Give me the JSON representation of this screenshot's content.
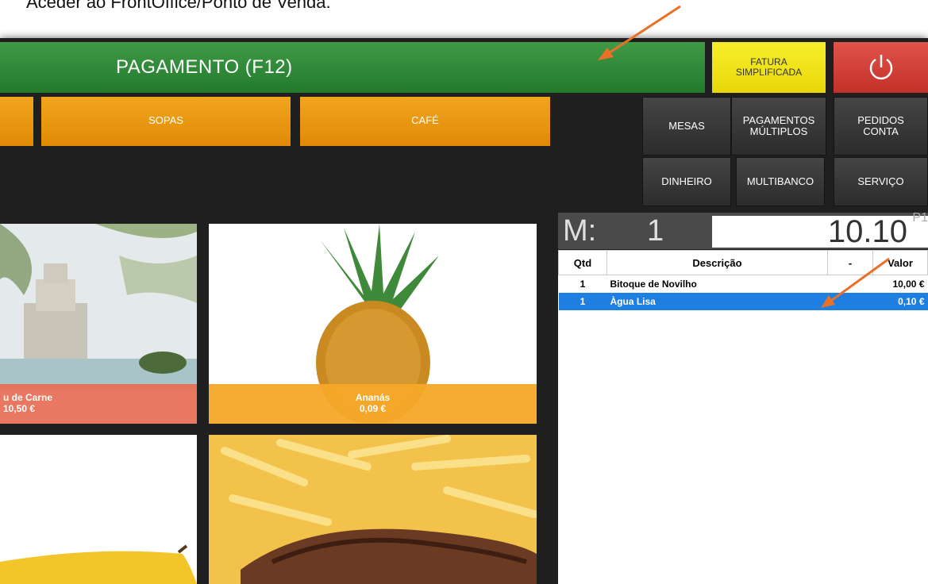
{
  "caption": "Aceder ao FrontOffice/Ponto de Venda.",
  "header": {
    "payment_label": "PAGAMENTO (F12)",
    "fatura_line1": "FATURA",
    "fatura_line2": "SIMPLIFICADA",
    "power_icon": "power-icon"
  },
  "categories": [
    "SOPAS",
    "CAFÉ"
  ],
  "functions": {
    "mesas": "MESAS",
    "pagamentos_line1": "PAGAMENTOS",
    "pagamentos_line2": "MÚLTIPLOS",
    "pedidos_line1": "PEDIDOS",
    "pedidos_line2": "CONTA",
    "dinheiro": "DINHEIRO",
    "multibanco": "MULTIBANCO",
    "servico": "SERVIÇO"
  },
  "products": [
    {
      "name": "u de Carne",
      "price": "10,50 €"
    },
    {
      "name": "Ananás",
      "price": "0,09 €"
    }
  ],
  "order": {
    "m_label": "M:",
    "m_value": "1",
    "total": "10.10",
    "price_level": "P1",
    "columns": [
      "Qtd",
      "Descrição",
      "-",
      "Valor"
    ],
    "rows": [
      {
        "qty": "1",
        "desc": "Bitoque de Novilho",
        "value": "10,00 €"
      },
      {
        "qty": "1",
        "desc": "Àgua Lisa",
        "value": "0,10 €"
      }
    ]
  },
  "colors": {
    "payment_green": "#2e8b38",
    "fatura_yellow": "#f2e71a",
    "power_red": "#d43d33",
    "category_orange": "#ee9a10",
    "selected_blue": "#1e7fe0",
    "annotation_arrow": "#e8712a"
  }
}
